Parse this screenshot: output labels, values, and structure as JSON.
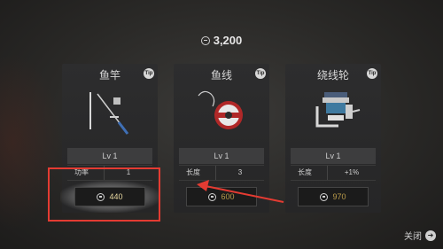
{
  "currency": {
    "amount": "3,200",
    "icon": "coin-icon"
  },
  "cards": [
    {
      "title": "鱼竿",
      "tip": "Tip",
      "level": "Lv 1",
      "stat_key": "功率",
      "stat_value": "1",
      "price": "440",
      "icon": "fishing-rod-icon"
    },
    {
      "title": "鱼线",
      "tip": "Tip",
      "level": "Lv 1",
      "stat_key": "长度",
      "stat_value": "3",
      "price": "600",
      "icon": "fishing-line-spool-icon"
    },
    {
      "title": "绕线轮",
      "tip": "Tip",
      "level": "Lv 1",
      "stat_key": "长度",
      "stat_value": "+1%",
      "price": "970",
      "icon": "fishing-reel-icon"
    }
  ],
  "close": {
    "label": "关闭",
    "icon": "arrow-right-icon"
  },
  "colors": {
    "highlight": "#e43b32",
    "price_text": "#b89a4a"
  }
}
